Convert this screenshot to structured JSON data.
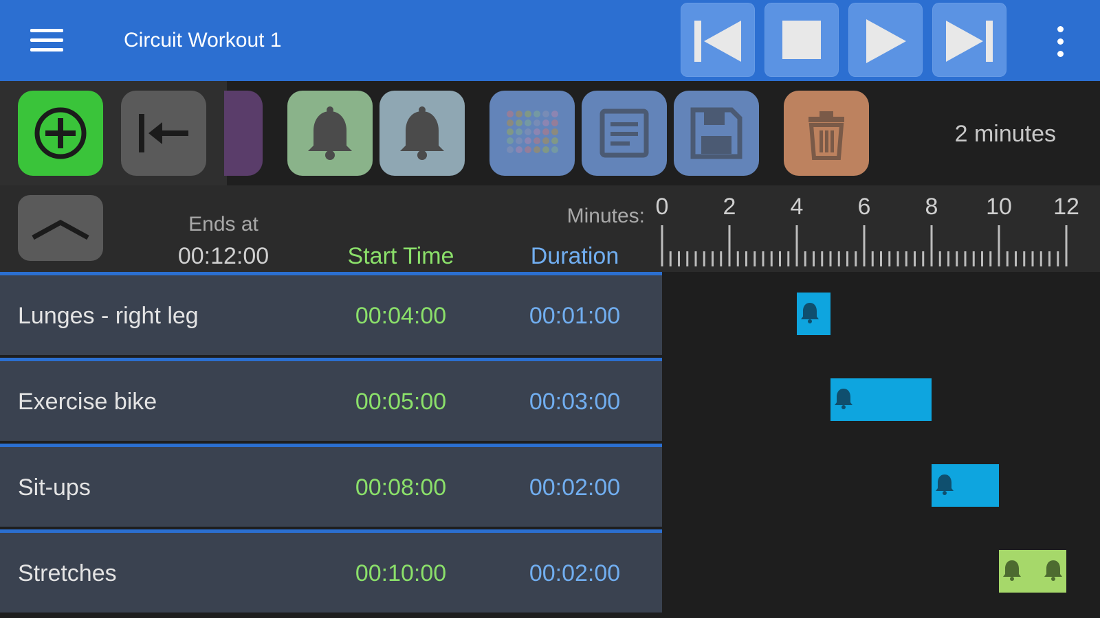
{
  "app": {
    "title": "Circuit Workout 1"
  },
  "transport": [
    "skip-previous",
    "stop",
    "play",
    "skip-next"
  ],
  "toolbar": {
    "scale_label": "2 minutes",
    "colors": {
      "add": "#3ac43a",
      "move_start": "#5a5a5a",
      "bell_green": "#8ab38a",
      "bell_gray": "#8fa7b3",
      "palette": "#6384b9",
      "notes": "#6384b9",
      "save": "#6384b9",
      "delete": "#bd825f"
    }
  },
  "header": {
    "ends_at_label": "Ends at",
    "ends_at_time": "00:12:00",
    "start_time_col": "Start Time",
    "duration_col": "Duration",
    "minutes_label": "Minutes:",
    "ticks": [
      "0",
      "2",
      "4",
      "6",
      "8",
      "10",
      "12"
    ]
  },
  "tasks": [
    {
      "name": "Lunges - right leg",
      "start": "00:04:00",
      "duration": "00:01:00",
      "start_min": 4,
      "duration_min": 1,
      "color": "#0ea5df",
      "bells": 1
    },
    {
      "name": "Exercise bike",
      "start": "00:05:00",
      "duration": "00:03:00",
      "start_min": 5,
      "duration_min": 3,
      "color": "#0ea5df",
      "bells": 1
    },
    {
      "name": "Sit-ups",
      "start": "00:08:00",
      "duration": "00:02:00",
      "start_min": 8,
      "duration_min": 2,
      "color": "#0ea5df",
      "bells": 1
    },
    {
      "name": "Stretches",
      "start": "00:10:00",
      "duration": "00:02:00",
      "start_min": 10,
      "duration_min": 2,
      "color": "#a6d86a",
      "bells": 2
    }
  ],
  "colors": {
    "appbar": "#2c6fd1",
    "row_bg": "#3a4250",
    "row_divider": "#2b6fd0",
    "start_text": "#8be06a",
    "duration_text": "#71aef0"
  }
}
